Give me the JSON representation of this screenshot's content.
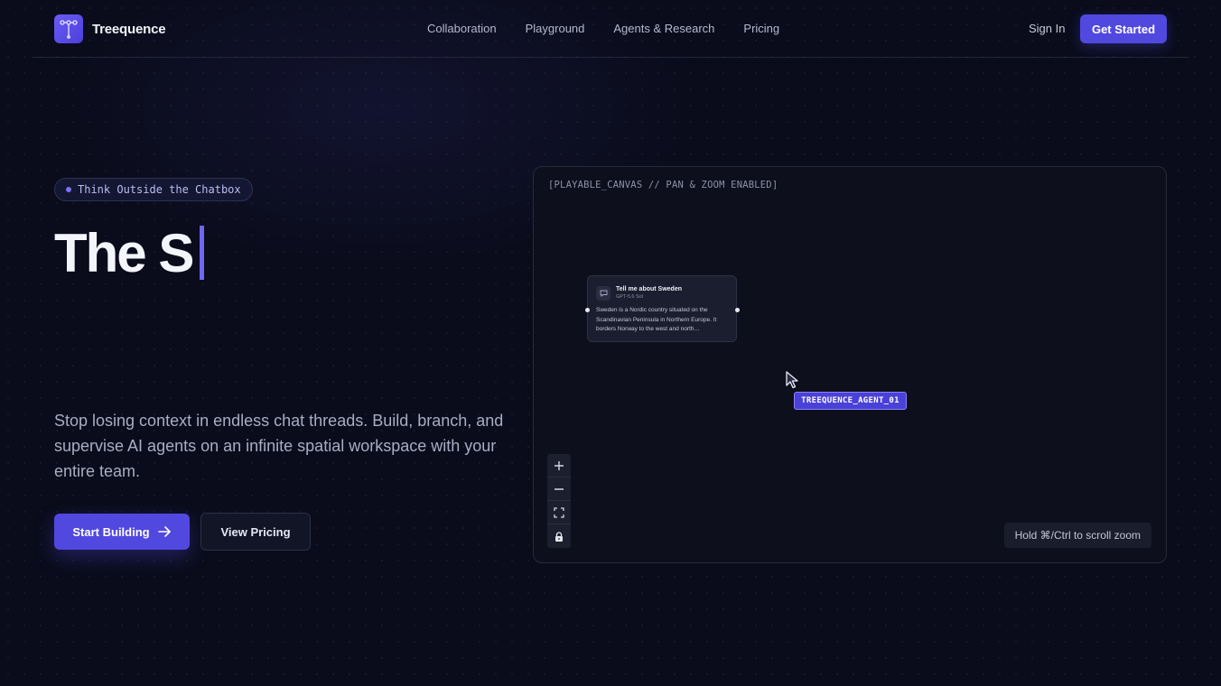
{
  "brand": {
    "name": "Treequence",
    "logo_icon": "tree-branch-icon",
    "accent": "#5148e0"
  },
  "nav": {
    "links": [
      "Collaboration",
      "Playground",
      "Agents & Research",
      "Pricing"
    ],
    "sign_in": "Sign In",
    "get_started": "Get Started"
  },
  "hero": {
    "tag": "Think Outside the Chatbox",
    "headline": "The S",
    "description": "Stop losing context in endless chat threads. Build, branch, and supervise AI agents on an infinite spatial workspace with your entire team.",
    "primary_button": "Start Building",
    "secondary_button": "View Pricing"
  },
  "canvas": {
    "label": "[PLAYABLE_CANVAS // PAN & ZOOM ENABLED]",
    "node": {
      "title": "Tell me about Sweden",
      "model": "GPT-5.6 Sol",
      "body": "Sweden is a Nordic country situated on the Scandinavian Peninsula in Northern Europe. It borders Norway to the west and north…"
    },
    "agent_label": "TREEQUENCE_AGENT_01",
    "zoom_hint": "Hold ⌘/Ctrl to scroll zoom",
    "controls": [
      "zoom-in-icon",
      "zoom-out-icon",
      "fit-view-icon",
      "lock-icon"
    ]
  }
}
